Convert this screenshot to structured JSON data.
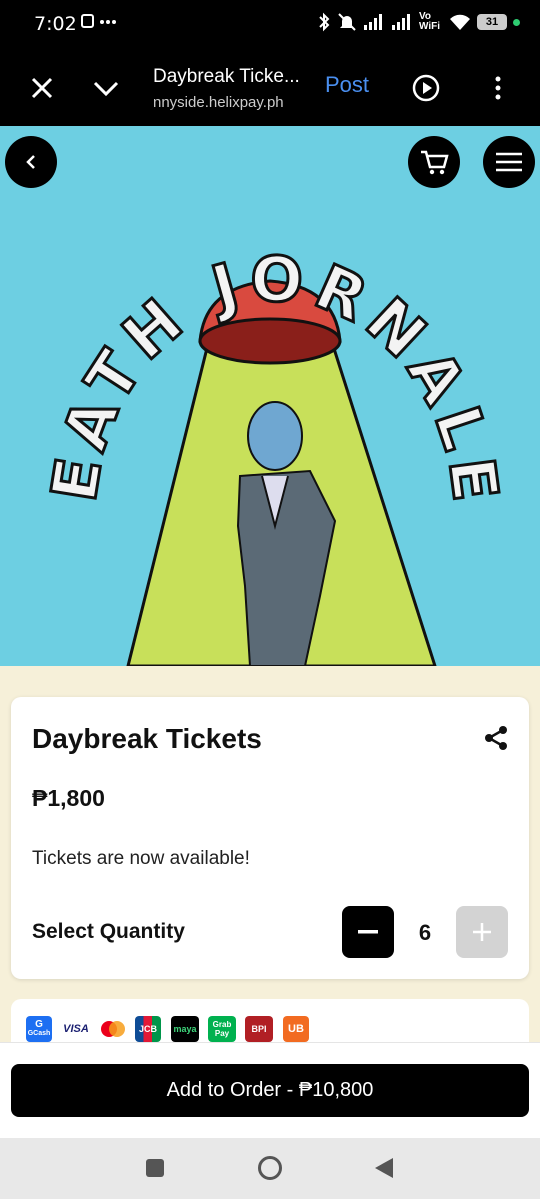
{
  "status_bar": {
    "time": "7:02",
    "network_label": "Vo WiFi",
    "battery": "31"
  },
  "app_bar": {
    "title": "Daybreak Ticke...",
    "url": "nnyside.helixpay.ph",
    "post_label": "Post"
  },
  "banner": {
    "artwork_text": "HEATH JORNALES",
    "background_color": "#6dcfe2"
  },
  "product": {
    "title": "Daybreak Tickets",
    "price": "₱1,800",
    "description": "Tickets are now available!",
    "quantity_label": "Select Quantity",
    "quantity": "6"
  },
  "payment_methods": [
    {
      "name": "GCash",
      "icon": "gcash-icon",
      "label": "G\nGCash"
    },
    {
      "name": "Visa",
      "icon": "visa-icon",
      "label": "VISA"
    },
    {
      "name": "Mastercard",
      "icon": "mastercard-icon",
      "label": "MasterCard"
    },
    {
      "name": "JCB",
      "icon": "jcb-icon",
      "label": "JCB"
    },
    {
      "name": "Maya",
      "icon": "maya-icon",
      "label": "maya"
    },
    {
      "name": "GrabPay",
      "icon": "grabpay-icon",
      "label": "Grab Pay"
    },
    {
      "name": "BPI",
      "icon": "bpi-icon",
      "label": "BPI"
    },
    {
      "name": "UnionBank",
      "icon": "unionbank-icon",
      "label": "UB"
    }
  ],
  "footer": {
    "add_button_label": "Add to Order - ₱10,800"
  },
  "colors": {
    "accent_link": "#4a8ff0",
    "primary_button": "#000000",
    "page_background": "#f6f0d9"
  }
}
